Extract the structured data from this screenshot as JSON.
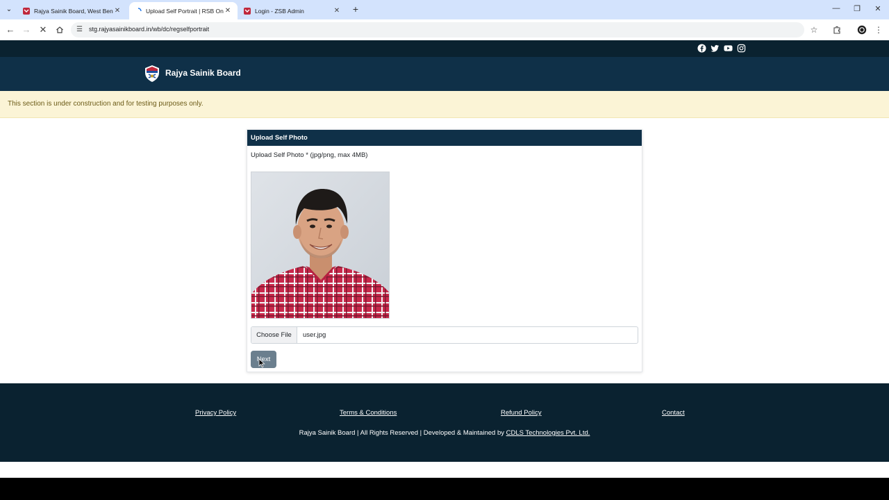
{
  "browser": {
    "tabs": [
      {
        "title": "Rajya Sainik Board, West Benga",
        "active": false
      },
      {
        "title": "Upload Self Portrait | RSB Onlin",
        "active": true
      },
      {
        "title": "Login - ZSB Admin",
        "active": false
      }
    ],
    "url": "stg.rajyasainikboard.in/wb/dc/regselfportrait",
    "icons": [
      "back-icon",
      "forward-icon",
      "stop-loading-icon",
      "home-icon",
      "site-settings-icon",
      "bookmark-star-icon",
      "extensions-icon",
      "profile-icon",
      "menu-icon"
    ]
  },
  "site": {
    "brand": "Rajya Sainik Board",
    "social_icons": [
      "facebook-icon",
      "twitter-icon",
      "youtube-icon",
      "instagram-icon"
    ],
    "notice": "This section is under construction and for testing purposes only."
  },
  "form": {
    "header": "Upload Self Photo",
    "label": "Upload Self Photo * (jpg/png, max 4MB)",
    "choose_file": "Choose File",
    "file_name": "user.jpg",
    "next": "Next"
  },
  "footer": {
    "links": [
      "Privacy Policy",
      "Terms & Conditions",
      "Refund Policy",
      "Contact"
    ],
    "copyright_text": "Rajya Sainik Board | All Rights Reserved | Developed & Maintained by ",
    "developer": "CDLS Technologies Pvt. Ltd."
  },
  "colors": {
    "header": "#0f3048",
    "topstrip": "#0a2230",
    "notice_bg": "#fbf4d6",
    "button": "#6b7f8e"
  }
}
